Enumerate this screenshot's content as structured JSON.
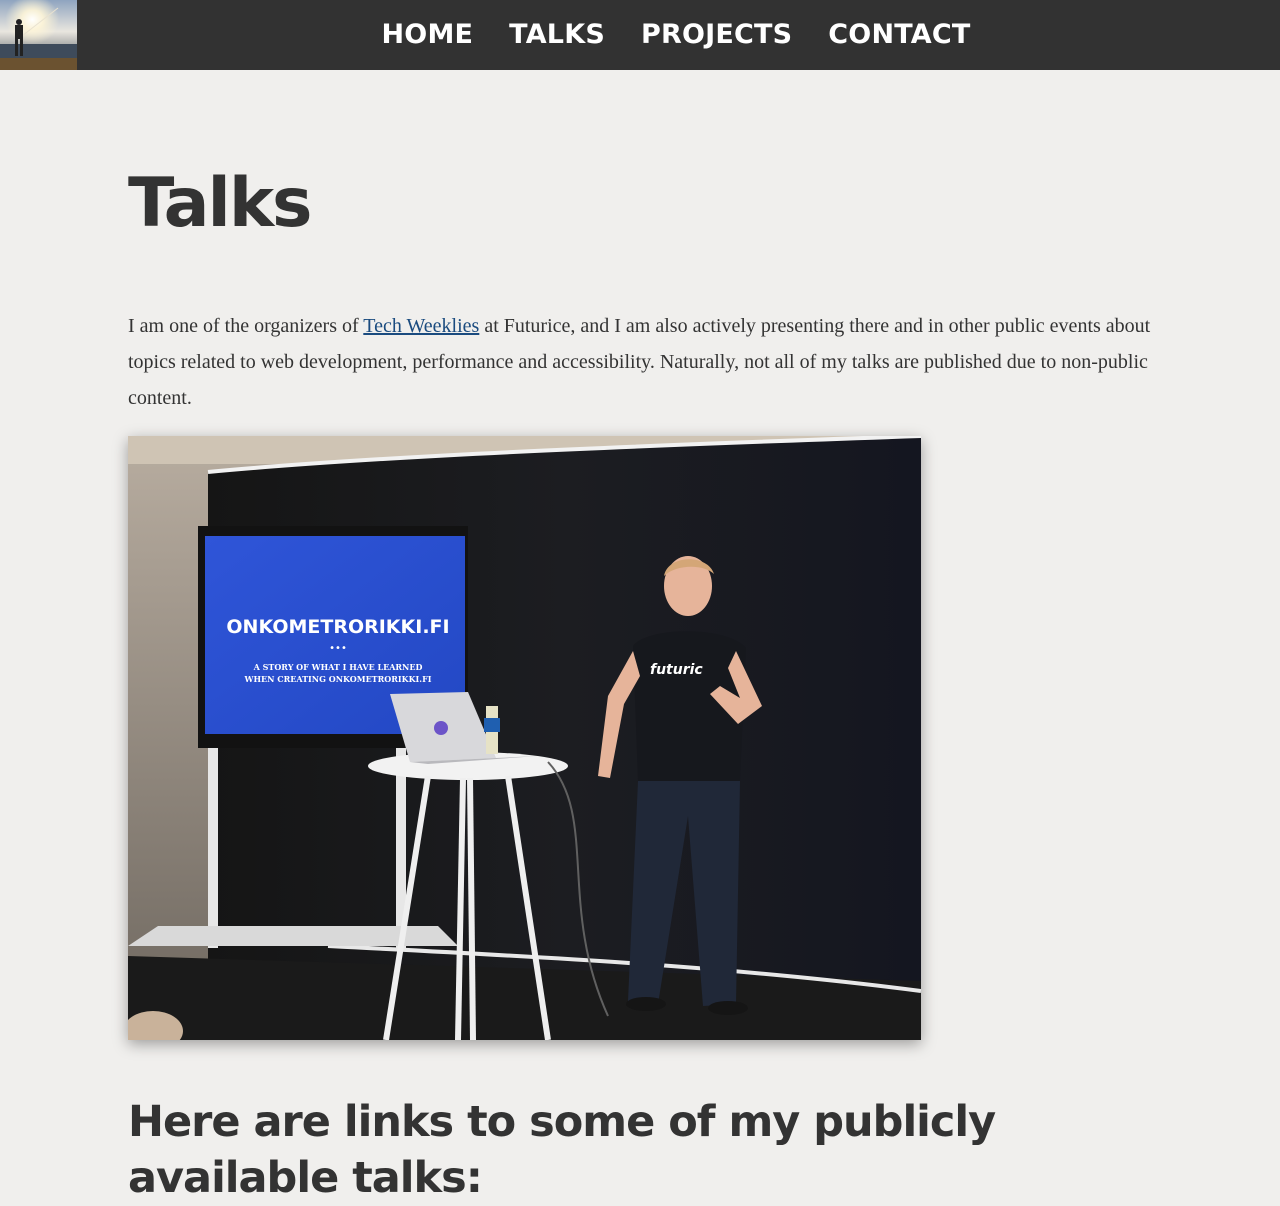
{
  "nav": {
    "items": [
      {
        "label": "HOME"
      },
      {
        "label": "TALKS"
      },
      {
        "label": "PROJECTS"
      },
      {
        "label": "CONTACT"
      }
    ]
  },
  "logo": {
    "icon": "fisherman-sunset-photo"
  },
  "main": {
    "title": "Talks",
    "intro": {
      "before_link": "I am one of the organizers of ",
      "link_text": "Tech Weeklies",
      "after_link": " at Futurice, and I am also actively presenting there and in other public events about topics related to web development, performance and accessibility. Naturally, not all of my talks are published due to non-public content."
    },
    "photo": {
      "slide_title": "ONKOMETRORIKKI.FI",
      "slide_dots": "•••",
      "slide_line1": "A STORY OF WHAT I HAVE LEARNED",
      "slide_line2": "WHEN CREATING ONKOMETRORIKKI.FI",
      "shirt_text": "futuric"
    },
    "links_heading": "Here are links to some of my publicly available talks:"
  },
  "colors": {
    "background": "#f0efed",
    "topbar": "#323232",
    "link": "#1a4b7f",
    "text": "#333333"
  }
}
